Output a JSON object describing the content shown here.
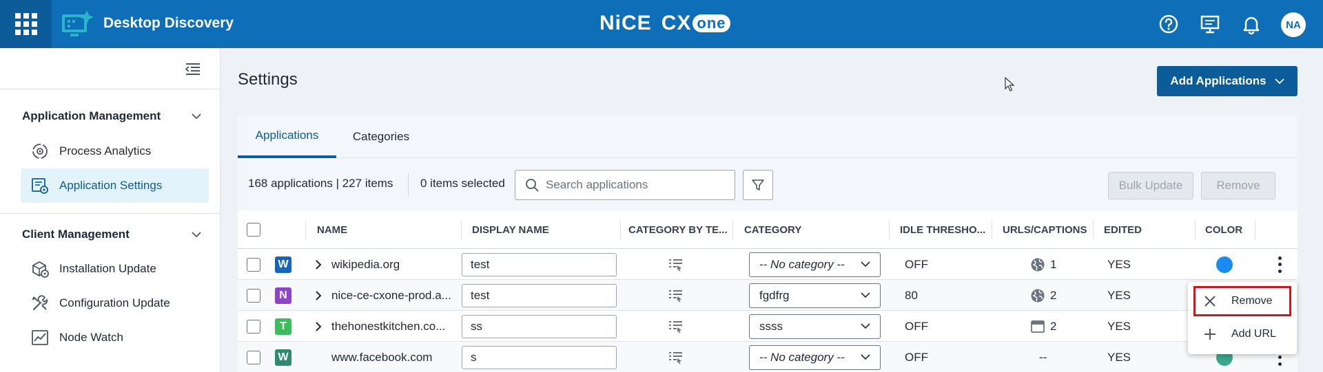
{
  "header": {
    "app_title": "Desktop Discovery",
    "brand_left": "NiCE",
    "brand_cx": "CX",
    "brand_one": "one",
    "avatar_initials": "NA"
  },
  "sidebar": {
    "sections": [
      {
        "title": "Application Management",
        "items": [
          {
            "label": "Process Analytics",
            "icon": "process-analytics-icon",
            "active": false
          },
          {
            "label": "Application Settings",
            "icon": "application-settings-icon",
            "active": true
          }
        ]
      },
      {
        "title": "Client Management",
        "items": [
          {
            "label": "Installation Update",
            "icon": "installation-update-icon",
            "active": false
          },
          {
            "label": "Configuration Update",
            "icon": "configuration-update-icon",
            "active": false
          },
          {
            "label": "Node Watch",
            "icon": "node-watch-icon",
            "active": false
          }
        ]
      }
    ]
  },
  "main": {
    "page_title": "Settings",
    "add_applications_label": "Add Applications",
    "tabs": [
      {
        "label": "Applications",
        "active": true
      },
      {
        "label": "Categories",
        "active": false
      }
    ],
    "toolbar": {
      "counts": "168 applications | 227 items",
      "selected": "0 items selected",
      "search_placeholder": "Search applications",
      "bulk_update_label": "Bulk Update",
      "remove_label": "Remove"
    },
    "columns": [
      "NAME",
      "DISPLAY NAME",
      "CATEGORY BY TE...",
      "CATEGORY",
      "IDLE THRESHO...",
      "URLS/CAPTIONS",
      "EDITED",
      "COLOR"
    ],
    "rows": [
      {
        "badge": "W",
        "badge_color": "#1565c0",
        "expandable": true,
        "name": "wikipedia.org",
        "display_name": "test",
        "category": "-- No category --",
        "category_placeholder": true,
        "idle": "OFF",
        "url_icon": "globe-icon",
        "url_count": "1",
        "edited": "YES",
        "color": "#1a8cf0"
      },
      {
        "badge": "N",
        "badge_color": "#8e44c9",
        "expandable": true,
        "name": "nice-ce-cxone-prod.a...",
        "display_name": "test",
        "category": "fgdfrg",
        "category_placeholder": false,
        "idle": "80",
        "url_icon": "globe-icon",
        "url_count": "2",
        "edited": "YES",
        "color": ""
      },
      {
        "badge": "T",
        "badge_color": "#3cbd5a",
        "expandable": true,
        "name": "thehonestkitchen.co...",
        "display_name": "ss",
        "category": "ssss",
        "category_placeholder": false,
        "idle": "OFF",
        "url_icon": "window-icon",
        "url_count": "2",
        "edited": "YES",
        "color": ""
      },
      {
        "badge": "W",
        "badge_color": "#2e8b6e",
        "expandable": false,
        "name": "www.facebook.com",
        "display_name": "s",
        "category": "-- No category --",
        "category_placeholder": true,
        "idle": "OFF",
        "url_icon": "",
        "url_count": "--",
        "edited": "YES",
        "color": "#3aa68a"
      }
    ],
    "row_menu": {
      "remove_label": "Remove",
      "add_url_label": "Add URL"
    }
  },
  "colors": {
    "header_blue": "#0e6fb8",
    "primary_button": "#0b5c99",
    "highlight_red": "#d4141c"
  }
}
